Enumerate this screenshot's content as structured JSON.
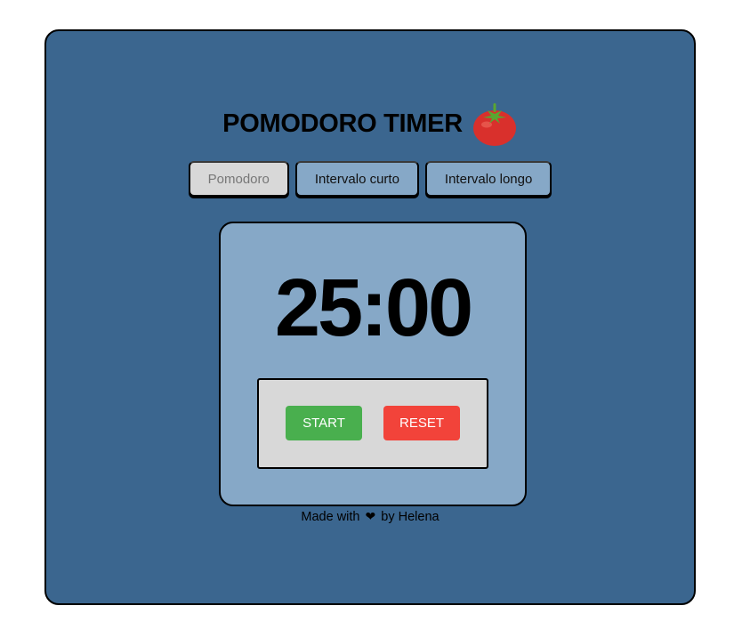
{
  "header": {
    "title": "POMODORO TIMER",
    "icon": "tomato-icon"
  },
  "tabs": [
    {
      "label": "Pomodoro",
      "active": true
    },
    {
      "label": "Intervalo curto",
      "active": false
    },
    {
      "label": "Intervalo longo",
      "active": false
    }
  ],
  "timer": {
    "display": "25:00"
  },
  "controls": {
    "start_label": "START",
    "reset_label": "RESET"
  },
  "footer": {
    "prefix": "Made with",
    "heart": "❤",
    "suffix": "by Helena"
  },
  "colors": {
    "background": "#3b668f",
    "card": "#86a8c7",
    "panel": "#d8d8d8",
    "start": "#49af4e",
    "reset": "#f2433a"
  }
}
